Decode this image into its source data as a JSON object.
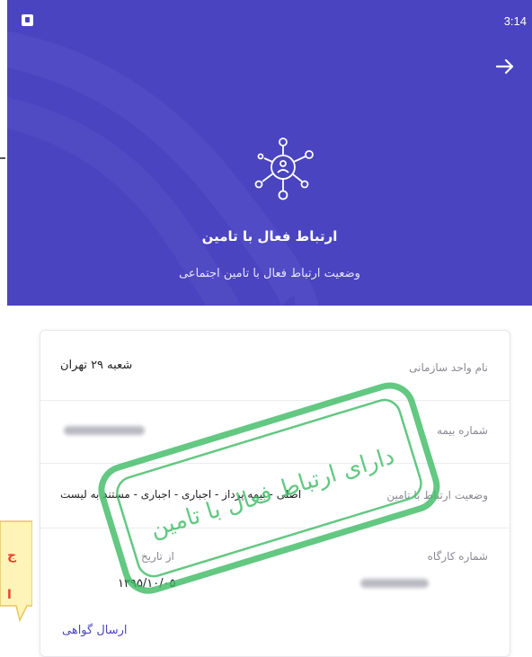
{
  "status_bar": {
    "time": "3:14"
  },
  "hero": {
    "title": "ارتباط فعال با تامین",
    "subtitle": "وضعیت ارتباط فعال با تامین اجتماعی"
  },
  "details": {
    "org_unit": {
      "label": "نام واحد سازمانی",
      "value": "شعبه ۲۹ تهران"
    },
    "insurance_number": {
      "label": "شماره بیمه"
    },
    "relation_status": {
      "label": "وضعیت ارتباط با تامین",
      "value": "اصلی - بیمه پرداز - اجباری - اجباری - مستند به لیست"
    },
    "workshop_number": {
      "label": "شماره کارگاه"
    },
    "from_date": {
      "label": "از تاریخ",
      "value": "۱۳۹۵/۱۰/۰۵"
    },
    "send_certificate_label": "ارسال گواهی"
  },
  "stamp": {
    "text": "دارای ارتباط فعال با تامین"
  },
  "callout": {
    "line1": "ج",
    "line2": "ا"
  },
  "colors": {
    "primary": "#4a44c0",
    "stamp": "#3dbb63",
    "callout_text": "#e8402a"
  }
}
